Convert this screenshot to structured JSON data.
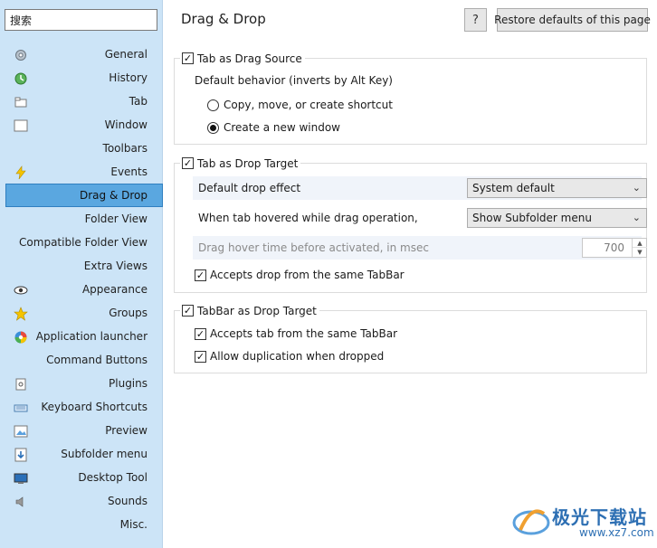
{
  "search": {
    "value": "搜索"
  },
  "sidebar": {
    "items": [
      {
        "label": "General",
        "icon": "gear-icon"
      },
      {
        "label": "History",
        "icon": "history-icon"
      },
      {
        "label": "Tab",
        "icon": "tab-icon"
      },
      {
        "label": "Window",
        "icon": "window-icon"
      },
      {
        "label": "Toolbars",
        "icon": ""
      },
      {
        "label": "Events",
        "icon": "lightning-icon"
      },
      {
        "label": "Drag & Drop",
        "icon": "",
        "selected": true
      },
      {
        "label": "Folder View",
        "icon": ""
      },
      {
        "label": "Compatible Folder View",
        "icon": ""
      },
      {
        "label": "Extra Views",
        "icon": ""
      },
      {
        "label": "Appearance",
        "icon": "eye-icon"
      },
      {
        "label": "Groups",
        "icon": "star-icon"
      },
      {
        "label": "Application launcher",
        "icon": "launcher-icon"
      },
      {
        "label": "Command Buttons",
        "icon": ""
      },
      {
        "label": "Plugins",
        "icon": "plugin-icon"
      },
      {
        "label": "Keyboard Shortcuts",
        "icon": "keyboard-icon"
      },
      {
        "label": "Preview",
        "icon": "preview-icon"
      },
      {
        "label": "Subfolder menu",
        "icon": "subfolder-icon"
      },
      {
        "label": "Desktop Tool",
        "icon": "desktop-icon"
      },
      {
        "label": "Sounds",
        "icon": "speaker-icon"
      },
      {
        "label": "Misc.",
        "icon": ""
      }
    ]
  },
  "header": {
    "title": "Drag & Drop",
    "help_label": "?",
    "restore_label": "Restore defaults of this page"
  },
  "drag_source": {
    "label": "Tab as Drag Source",
    "checked": true,
    "behavior_label": "Default behavior (inverts by Alt Key)",
    "options": [
      {
        "label": "Copy, move, or create shortcut",
        "selected": false
      },
      {
        "label": "Create a new window",
        "selected": true
      }
    ]
  },
  "drop_target": {
    "label": "Tab as Drop Target",
    "checked": true,
    "drop_effect_label": "Default drop effect",
    "drop_effect_value": "System default",
    "hover_label": "When tab hovered while drag operation,",
    "hover_value": "Show Subfolder menu",
    "hover_time_label": "Drag hover time before activated, in msec",
    "hover_time_value": "700",
    "same_tabbar_label": "Accepts drop from the same TabBar",
    "same_tabbar_checked": true
  },
  "tabbar_target": {
    "label": "TabBar as Drop Target",
    "checked": true,
    "accept_label": "Accepts tab from the same TabBar",
    "accept_checked": true,
    "dup_label": "Allow duplication when dropped",
    "dup_checked": true
  },
  "watermark": {
    "text": "极光下载站",
    "url": "www.xz7.com"
  }
}
